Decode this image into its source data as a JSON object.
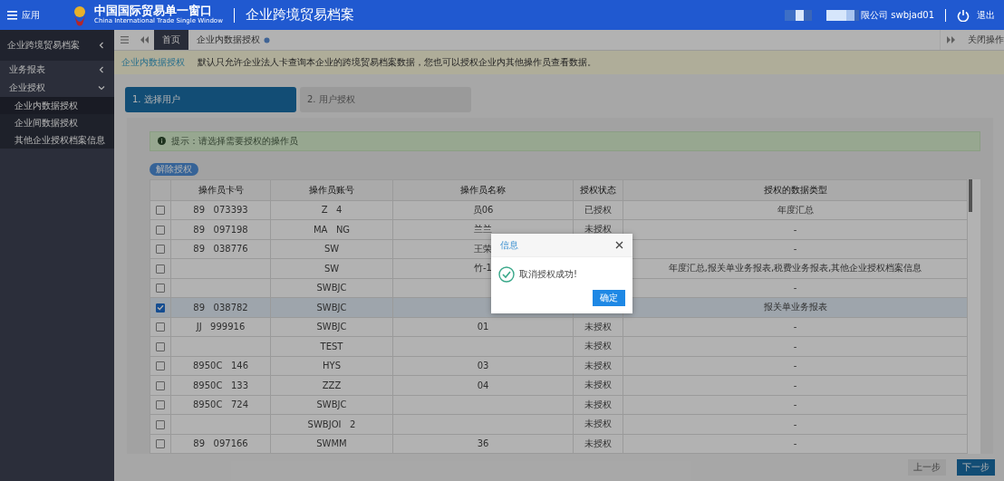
{
  "header": {
    "menu_label": "应用",
    "logo_title": "中国国际贸易单一窗口",
    "logo_subtitle": "China International Trade Single Window",
    "app_title": "企业跨境贸易档案",
    "user": "限公司 swbjad01",
    "logout": "退出"
  },
  "sidebar": {
    "title": "企业跨境贸易档案",
    "items": [
      {
        "label": "业务报表",
        "expanded": false
      },
      {
        "label": "企业授权",
        "expanded": true,
        "children": [
          {
            "label": "企业内数据授权",
            "selected": true
          },
          {
            "label": "企业间数据授权",
            "selected": false
          },
          {
            "label": "其他企业授权档案信息",
            "selected": false
          }
        ]
      }
    ]
  },
  "tabs": [
    {
      "label": "首页",
      "kind": "home",
      "selected": false
    },
    {
      "label": "企业内数据授权",
      "kind": "page",
      "selected": true
    }
  ],
  "close_menu": "关闭操作",
  "page": {
    "title": "企业内数据授权",
    "description": "默认只允许企业法人卡查询本企业的跨境贸易档案数据，您也可以授权企业内其他操作员查看数据。"
  },
  "steps": [
    {
      "label": "1. 选择用户",
      "selected": true
    },
    {
      "label": "2. 用户授权",
      "selected": false
    }
  ],
  "tip": "提示：请选择需要授权的操作员",
  "revoke_button": "解除授权",
  "table": {
    "columns": [
      "操作员卡号",
      "操作员账号",
      "操作员名称",
      "授权状态",
      "授权的数据类型"
    ],
    "rows": [
      {
        "checked": false,
        "cells": [
          "89   073393",
          "Z   4",
          "员06",
          "已授权",
          "年度汇总"
        ]
      },
      {
        "checked": false,
        "cells": [
          "89   097198",
          "MA   NG",
          "兰兰",
          "未授权",
          "-"
        ]
      },
      {
        "checked": false,
        "cells": [
          "89   038776",
          "SW",
          "王荣",
          null,
          "-"
        ]
      },
      {
        "checked": false,
        "cells": [
          "",
          "SW",
          "竹-1",
          null,
          "年度汇总,报关单业务报表,税费业务报表,其他企业授权档案信息"
        ]
      },
      {
        "checked": false,
        "cells": [
          "",
          "SWBJC",
          "",
          null,
          "-"
        ]
      },
      {
        "checked": true,
        "cells": [
          "89   038782",
          "SWBJC",
          "",
          null,
          "报关单业务报表"
        ]
      },
      {
        "checked": false,
        "cells": [
          "JJ   999916",
          "SWBJC",
          "01",
          "未授权",
          "-"
        ]
      },
      {
        "checked": false,
        "cells": [
          "",
          "TEST",
          "",
          "未授权",
          "-"
        ]
      },
      {
        "checked": false,
        "cells": [
          "8950C   146",
          "HYS",
          "03",
          "未授权",
          "-"
        ]
      },
      {
        "checked": false,
        "cells": [
          "8950C   133",
          "ZZZ",
          "04",
          "未授权",
          "-"
        ]
      },
      {
        "checked": false,
        "cells": [
          "8950C   724",
          "SWBJC",
          "",
          "未授权",
          "-"
        ]
      },
      {
        "checked": false,
        "cells": [
          "",
          "SWBJOI   2",
          "",
          "未授权",
          "-"
        ]
      },
      {
        "checked": false,
        "cells": [
          "89   097166",
          "SWMM",
          "36",
          "未授权",
          "-"
        ]
      }
    ]
  },
  "footer_buttons": [
    {
      "label": "上一步",
      "kind": "secondary"
    },
    {
      "label": "下一步",
      "kind": "primary"
    }
  ],
  "dialog": {
    "title": "信息",
    "message": "取消授权成功!",
    "ok": "确定"
  }
}
